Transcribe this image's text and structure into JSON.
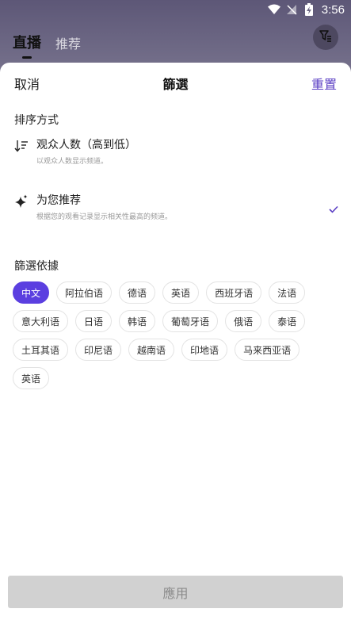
{
  "status_bar": {
    "time": "3:56"
  },
  "top_tabs": [
    {
      "label": "直播",
      "active": true
    },
    {
      "label": "推荐",
      "active": false
    }
  ],
  "sheet": {
    "cancel_label": "取消",
    "title": "篩選",
    "reset_label": "重置",
    "sort_section_title": "排序方式",
    "sort_options": [
      {
        "title": "观众人数（高到低）",
        "subtitle": "以观众人数显示频道。",
        "icon": "sort-descending-icon",
        "selected": false
      },
      {
        "title": "为您推荐",
        "subtitle": "根据您的观看记录显示相关性最高的频道。",
        "icon": "sparkle-icon",
        "selected": true
      }
    ],
    "filter_section_title": "篩選依據",
    "languages": [
      "中文",
      "阿拉伯语",
      "德语",
      "英语",
      "西班牙语",
      "法语",
      "意大利语",
      "日语",
      "韩语",
      "葡萄牙语",
      "俄语",
      "泰语",
      "土耳其语",
      "印尼语",
      "越南语",
      "印地语",
      "马来西亚语",
      "英语"
    ],
    "selected_language_index": 0,
    "apply_label": "應用"
  },
  "colors": {
    "accent": "#5b3fe0",
    "reset": "#5b3fc4",
    "apply_disabled_bg": "#d1d1d1"
  }
}
